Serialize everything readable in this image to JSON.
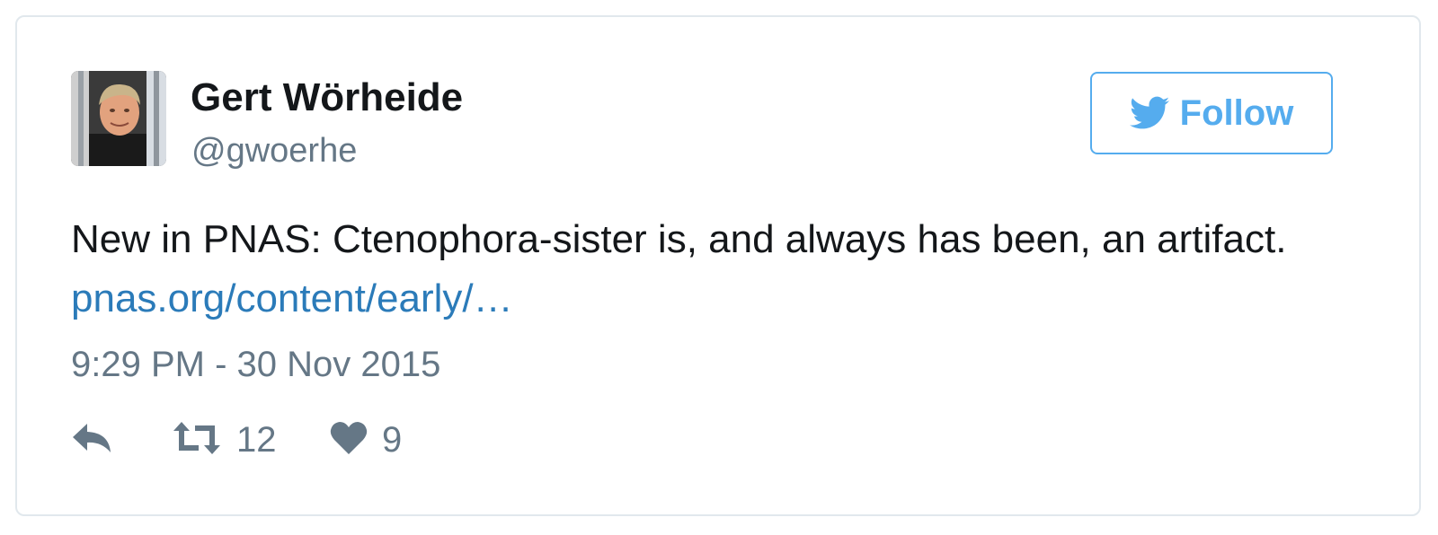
{
  "tweet": {
    "author": {
      "name": "Gert Wörheide",
      "handle": "@gwoerhe"
    },
    "follow_label": "Follow",
    "text_plain": "New in PNAS: Ctenophora-sister is, and always has been, an artifact. ",
    "link_text": "pnas.org/content/early/…",
    "timestamp": "9:29 PM - 30 Nov 2015",
    "retweet_count": "12",
    "like_count": "9"
  },
  "icons": {
    "follow": "twitter-bird-icon",
    "reply": "reply-icon",
    "retweet": "retweet-icon",
    "like": "heart-icon"
  },
  "colors": {
    "accent": "#55acee",
    "link": "#2b7bb9",
    "text": "#14171a",
    "muted": "#657786",
    "border": "#e1e8ed"
  }
}
